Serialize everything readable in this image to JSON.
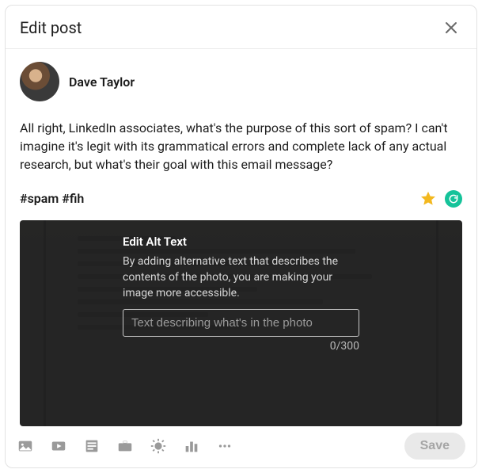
{
  "header": {
    "title": "Edit post"
  },
  "author": {
    "name": "Dave Taylor"
  },
  "post": {
    "body": "All right, LinkedIn associates, what's the purpose of this sort of spam? I can't imagine it's legit with its grammatical errors and complete lack of any actual research, but what's their goal with this email message?",
    "hashtags": "#spam #fih"
  },
  "altTextPanel": {
    "title": "Edit Alt Text",
    "description": "By adding alternative text that describes the contents of the photo, you are making your image more accessible.",
    "placeholder": "Text describing what's in the photo",
    "value": "",
    "charCount": "0/300"
  },
  "footer": {
    "saveLabel": "Save"
  }
}
